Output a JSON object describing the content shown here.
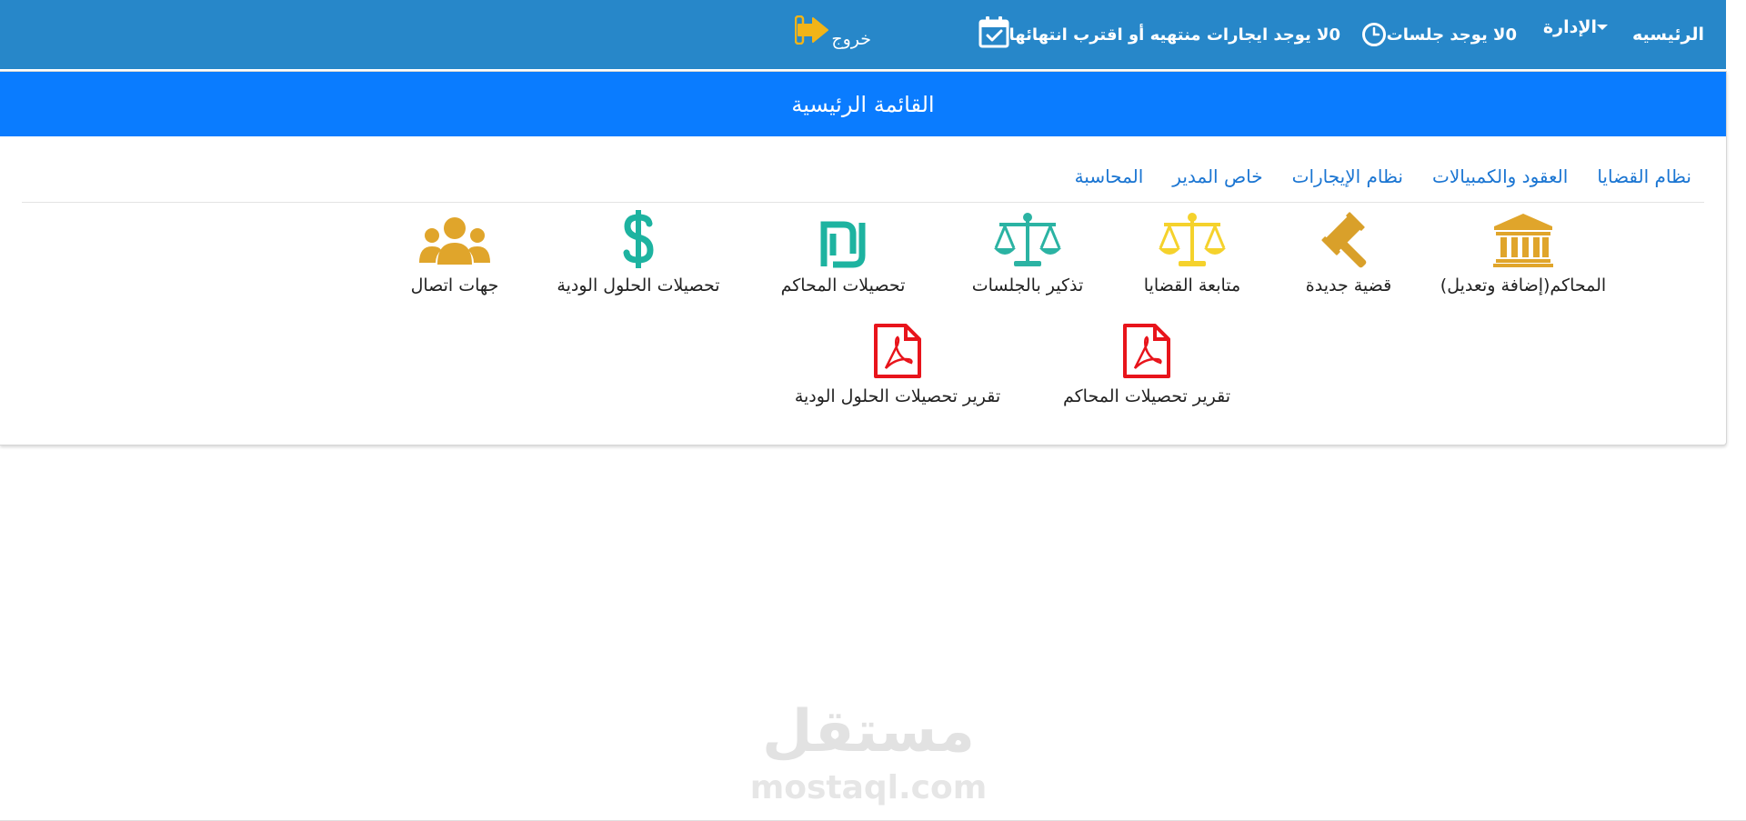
{
  "navbar": {
    "home": "الرئيسيه",
    "admin": "الإدارة",
    "sessions_text": "لا يوجد جلسات",
    "sessions_count": "0",
    "leases_text": "لا يوجد ايجارات منتهيه أو اقترب انتهائها",
    "leases_count": "0",
    "logout": "خروج"
  },
  "panel": {
    "title": "القائمة الرئيسية",
    "tabs": [
      "نظام القضايا",
      "العقود والكمبيالات",
      "نظام الإيجارات",
      "خاص المدير",
      "المحاسبة"
    ],
    "row1": [
      {
        "label": "المحاكم(إضافة وتعديل)",
        "icon": "courthouse-icon",
        "color": "#e0a52b"
      },
      {
        "label": "قضية جديدة",
        "icon": "gavel-icon",
        "color": "#d9a02a"
      },
      {
        "label": "متابعة القضايا",
        "icon": "scales-icon",
        "color": "#f5d22c"
      },
      {
        "label": "تذكير بالجلسات",
        "icon": "scales-icon",
        "color": "#2bb3a3"
      },
      {
        "label": "تحصيلات المحاكم",
        "icon": "shekel-icon",
        "color": "#1db3a0"
      },
      {
        "label": "تحصيلات الحلول الودية",
        "icon": "dollar-icon",
        "color": "#1db3a0"
      },
      {
        "label": "جهات اتصال",
        "icon": "users-icon",
        "color": "#e0a52b"
      }
    ],
    "row2": [
      {
        "label": "تقرير تحصيلات المحاكم",
        "icon": "pdf-icon",
        "color": "#e8141b"
      },
      {
        "label": "تقرير تحصيلات الحلول الودية",
        "icon": "pdf-icon",
        "color": "#e8141b"
      }
    ]
  },
  "watermark": {
    "arabic": "مستقل",
    "latin": "mostaql.com"
  },
  "colors": {
    "navbar": "#2787c9",
    "panel_header": "#0a7cff",
    "tab_link": "#1a75d2",
    "logout_icon": "#f2b418"
  }
}
